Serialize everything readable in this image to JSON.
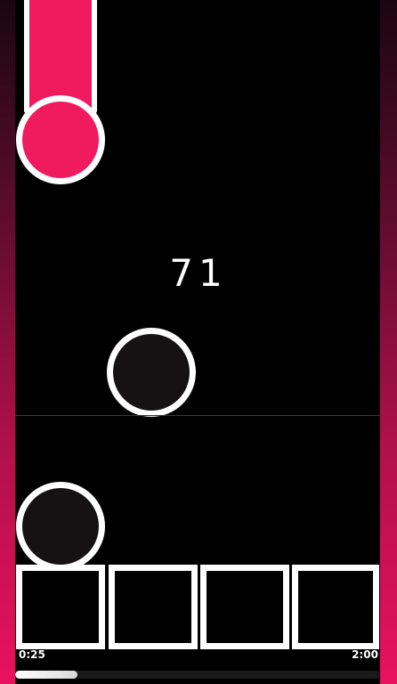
{
  "game": {
    "score": "71",
    "time_current": "0:25",
    "time_total": "2:00",
    "progress": 0.17
  },
  "colors": {
    "accent": "#f01a5e",
    "note_fill": "#161112",
    "outline": "#ffffff",
    "background": "#000000"
  },
  "lanes": [
    "lane-1",
    "lane-2",
    "lane-3",
    "lane-4"
  ]
}
